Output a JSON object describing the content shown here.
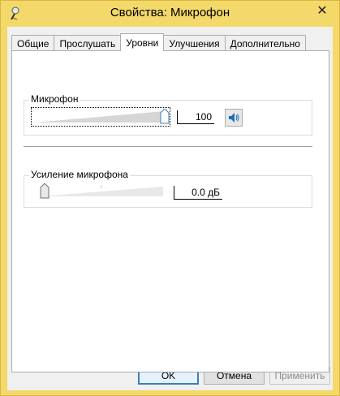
{
  "window": {
    "title": "Свойства: Микрофон",
    "close_symbol": "✕",
    "icon": "microphone-icon",
    "accent": "#f3d96a"
  },
  "tabs": [
    {
      "label": "Общие",
      "active": false
    },
    {
      "label": "Прослушать",
      "active": false
    },
    {
      "label": "Уровни",
      "active": true
    },
    {
      "label": "Улучшения",
      "active": false
    },
    {
      "label": "Дополнительно",
      "active": false
    }
  ],
  "microphone": {
    "label": "Микрофон",
    "level": 1.0,
    "value": "100",
    "mute_icon": "speaker-icon"
  },
  "boost": {
    "label": "Усиление микрофона",
    "level": 0.0,
    "value": "0.0 дБ"
  },
  "buttons": {
    "ok": "OK",
    "cancel": "Отмена",
    "apply": "Применить"
  }
}
